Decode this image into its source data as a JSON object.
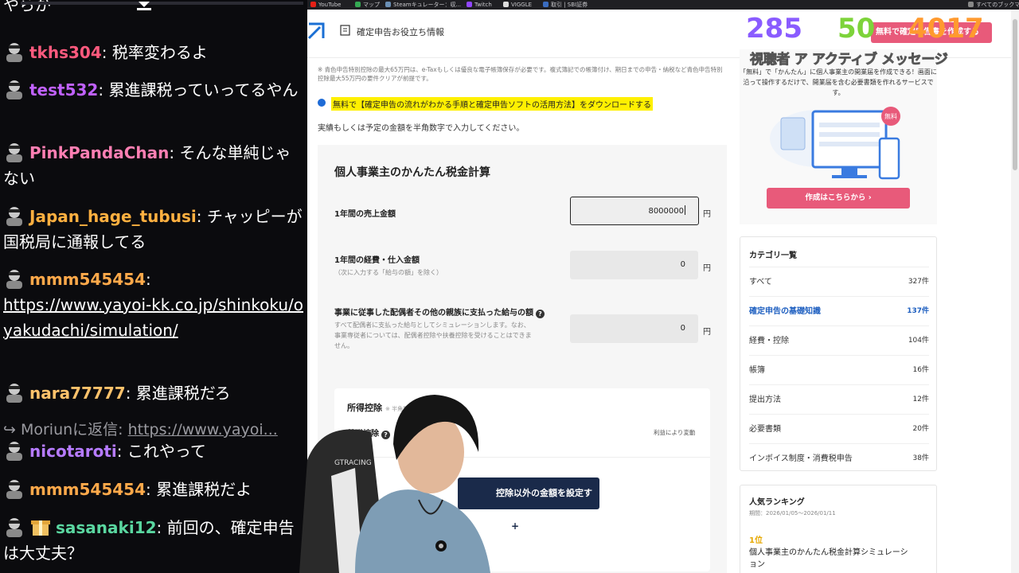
{
  "chat": {
    "partial_top": "やらが",
    "messages": [
      {
        "user": "tkhs304",
        "color": "#ff5a7e",
        "text": ": 税率変わるよ"
      },
      {
        "user": "test532",
        "color": "#c061ff",
        "text": ": 累進課税っていってるやん"
      },
      {
        "user": "PinkPandaChan",
        "color": "#ff7fb3",
        "text": ": そんな単純じゃない"
      },
      {
        "user": "Japan_hage_tubusi",
        "color": "#ffb040",
        "text": ": チャッピーが国税局に通報してる"
      },
      {
        "user": "mmm545454",
        "color": "#ffa94a",
        "text": ":",
        "link": "https://www.yayoi-kk.co.jp/shinkoku/oyakudachi/simulation/"
      },
      {
        "user": "nara77777",
        "color": "#ffc26b",
        "text": ": 累進課税だろ"
      },
      {
        "reply": "Moriunに返信: ",
        "link": "https://www.yayoi..."
      },
      {
        "user": "nicotaroti",
        "color": "#b67bff",
        "text": ": これやって"
      },
      {
        "user": "mmm545454",
        "color": "#ffa94a",
        "text": ": 累進課税だよ"
      },
      {
        "user": "sasanaki12",
        "color": "#5ad7a0",
        "text": ": 前回の、確定申告は大丈夫？"
      }
    ]
  },
  "bookmarks": [
    "YouTube",
    "マップ",
    "Steamキュレーター：収...",
    "Twitch",
    "VIGGLE",
    "取引 | SBI証券",
    "すべてのブックマーク"
  ],
  "overlay": {
    "viewers": "285",
    "active": "50",
    "messages": "4017",
    "labels": "視聴者 ア アクティブ メッセージ",
    "pink_tag": "無料で確定申告書を作成する"
  },
  "page": {
    "header_title": "確定申告お役立ち情報",
    "note": "※ 青色申告特別控除の最大65万円は、e-Taxもしくは優良な電子帳簿保存が必要です。複式簿記での帳簿付け、期日までの申告・納税など青色申告特別控除最大55万円の要件クリアが前提です。",
    "download_link": "無料で【確定申告の流れがわかる手順と確定申告ソフトの活用方法】をダウンロードする",
    "instruction": "実績もしくは予定の金額を半角数字で入力してください。",
    "calc_title": "個人事業主のかんたん税金計算",
    "rows": [
      {
        "label": "1年間の売上金額",
        "sub": "",
        "value": "8000000",
        "unit": "円"
      },
      {
        "label": "1年間の経費・仕入金額",
        "sub": "（次に入力する「給与の額」を除く）",
        "value": "0",
        "unit": "円"
      },
      {
        "label": "事業に従事した配偶者その他の親族に支払った給与の額",
        "sub": "すべて配偶者に支払った給与としてシミュレーションします。なお、事業専従者については、配偶者控除や扶養控除を受けることはできません。",
        "value": "0",
        "unit": "円"
      }
    ],
    "deduction_title": "所得控除",
    "deduction_hint": "※ 半角数字",
    "basic_label": "基礎控除",
    "basic_value": "利益により変動",
    "deduction_button": "控除以外の金額を設定する",
    "promo_text": "「無料」で「かんたん」に個人事業主の開業届を作成できる！画面に沿って操作するだけで、開業届を含む必要書類を作れるサービスです。",
    "promo_badge": "無料",
    "promo_button": "作成はこちらから",
    "categories_title": "カテゴリ一覧",
    "categories": [
      {
        "name": "すべて",
        "count": "327件"
      },
      {
        "name": "確定申告の基礎知識",
        "count": "137件"
      },
      {
        "name": "経費・控除",
        "count": "104件"
      },
      {
        "name": "帳簿",
        "count": "16件"
      },
      {
        "name": "提出方法",
        "count": "12件"
      },
      {
        "name": "必要書類",
        "count": "20件"
      },
      {
        "name": "インボイス制度・消費税申告",
        "count": "38件"
      }
    ],
    "ranking_title": "人気ランキング",
    "ranking_period": "期間：2026/01/05〜2026/01/11",
    "ranking_items": [
      {
        "rank": "1位",
        "title": "個人事業主のかんたん税金計算シミュレーション"
      }
    ]
  }
}
